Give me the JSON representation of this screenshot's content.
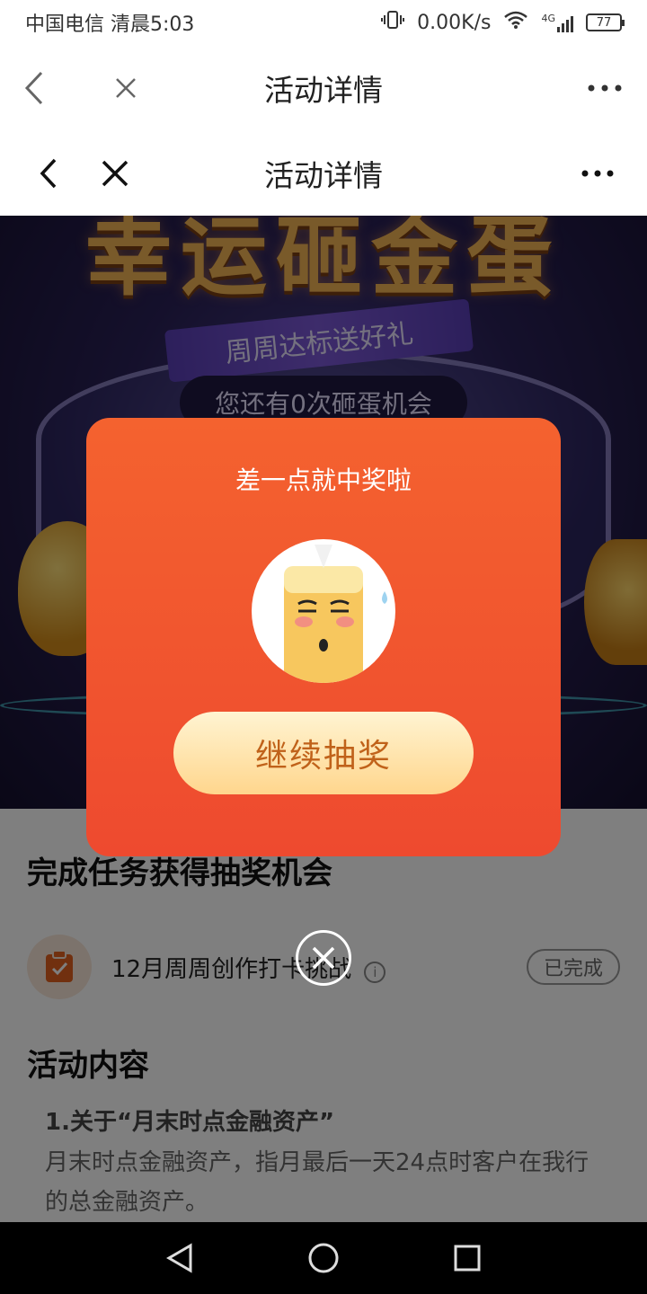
{
  "status_bar": {
    "carrier_time": "中国电信 清晨5:03",
    "net_speed": "0.00K/s",
    "network": "4G",
    "battery": "77"
  },
  "nav_outer": {
    "title": "活动详情"
  },
  "nav_inner": {
    "title": "活动详情"
  },
  "banner": {
    "title": "幸运砸金蛋",
    "ribbon": "周周达标送好礼",
    "chances": "您还有0次砸蛋机会"
  },
  "tasks_section": {
    "title": "完成任务获得抽奖机会",
    "task": {
      "label": "12月周周创作打卡挑战",
      "status": "已完成"
    }
  },
  "activity_section": {
    "title": "活动内容",
    "item_heading": "1.关于“月末时点金融资产”",
    "item_body": "月末时点金融资产，指月最后一天24点时客户在我行的总金融资产。"
  },
  "modal": {
    "message": "差一点就中奖啦",
    "button": "继续抽奖"
  },
  "colors": {
    "modal_top": "#f4622f",
    "modal_bottom": "#ee4a2f",
    "button_text": "#c0621a"
  },
  "icons": [
    "back-icon",
    "close-icon",
    "more-icon",
    "info-icon",
    "clipboard-icon",
    "circle-close-icon",
    "nav-back-icon",
    "nav-home-icon",
    "nav-recents-icon"
  ]
}
